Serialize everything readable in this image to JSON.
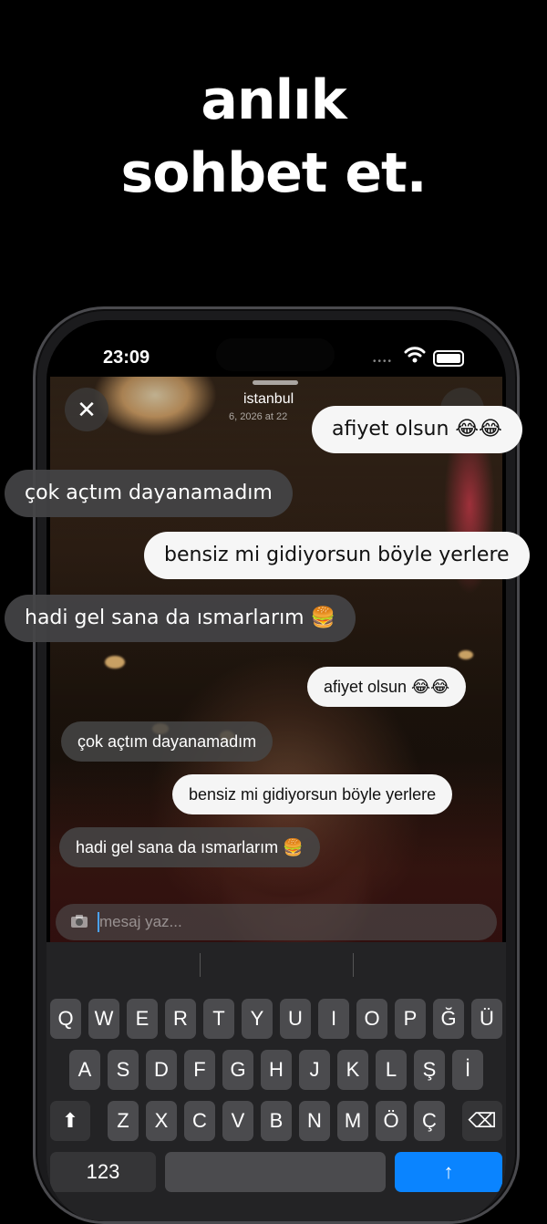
{
  "headline": {
    "line1": "anlık",
    "line2": "sohbet et."
  },
  "status_bar": {
    "time": "23:09",
    "signal": "••••"
  },
  "story": {
    "location": "istanbul",
    "date": "6, 2026 at 22",
    "close_glyph": "✕"
  },
  "overlay_bubbles": [
    {
      "text": "afiyet olsun 😂😂",
      "style": "white"
    },
    {
      "text": "çok açtım dayanamadım",
      "style": "dark"
    },
    {
      "text": "bensiz mi gidiyorsun böyle yerlere",
      "style": "white"
    },
    {
      "text": "hadi gel sana da ısmarlarım 🍔",
      "style": "dark"
    }
  ],
  "chat_bubbles": [
    {
      "text": "afiyet olsun 😂😂",
      "style": "white"
    },
    {
      "text": "çok açtım dayanamadım",
      "style": "dark"
    },
    {
      "text": "bensiz mi gidiyorsun böyle yerlere",
      "style": "white"
    },
    {
      "text": "hadi gel sana da ısmarlarım 🍔",
      "style": "dark"
    }
  ],
  "message_input": {
    "placeholder": "mesaj yaz..."
  },
  "keyboard": {
    "row1": [
      "Q",
      "W",
      "E",
      "R",
      "T",
      "Y",
      "U",
      "I",
      "O",
      "P",
      "Ğ",
      "Ü"
    ],
    "row2": [
      "A",
      "S",
      "D",
      "F",
      "G",
      "H",
      "J",
      "K",
      "L",
      "Ş",
      "İ"
    ],
    "row3": [
      "Z",
      "X",
      "C",
      "V",
      "B",
      "N",
      "M",
      "Ö",
      "Ç"
    ],
    "shift": "⬆",
    "delete": "⌫",
    "numbers": "123",
    "send": "↑"
  },
  "colors": {
    "background": "#000000",
    "accent": "#0a84ff",
    "bubble_light": "#f6f6f6",
    "bubble_dark": "#444446"
  }
}
